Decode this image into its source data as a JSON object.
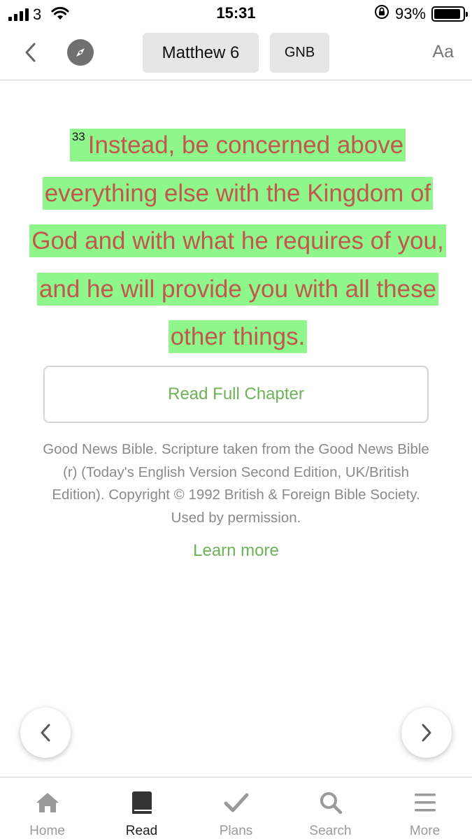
{
  "status_bar": {
    "carrier": "3",
    "time": "15:31",
    "battery_percent": "93%",
    "battery_level": 0.93
  },
  "nav": {
    "book": "Matthew 6",
    "version": "GNB",
    "text_settings": "Aa"
  },
  "verse": {
    "number": "33",
    "text": "Instead, be concerned above everything else with the Kingdom of God and with what he requires of you, and he will provide you with all these other things.",
    "highlight_color": "#8ef68a",
    "text_color": "#c0584c"
  },
  "read_full_chapter": "Read Full Chapter",
  "copyright": "Good News Bible. Scripture taken from the Good News Bible (r) (Today's English Version Second Edition, UK/British Edition). Copyright © 1992 British & Foreign Bible Society. Used by permission.",
  "learn_more": "Learn more",
  "accent_color": "#6db356",
  "tabs": [
    {
      "label": "Home",
      "icon": "home-icon",
      "active": false
    },
    {
      "label": "Read",
      "icon": "book-icon",
      "active": true
    },
    {
      "label": "Plans",
      "icon": "checkmark-icon",
      "active": false
    },
    {
      "label": "Search",
      "icon": "search-icon",
      "active": false
    },
    {
      "label": "More",
      "icon": "menu-icon",
      "active": false
    }
  ]
}
